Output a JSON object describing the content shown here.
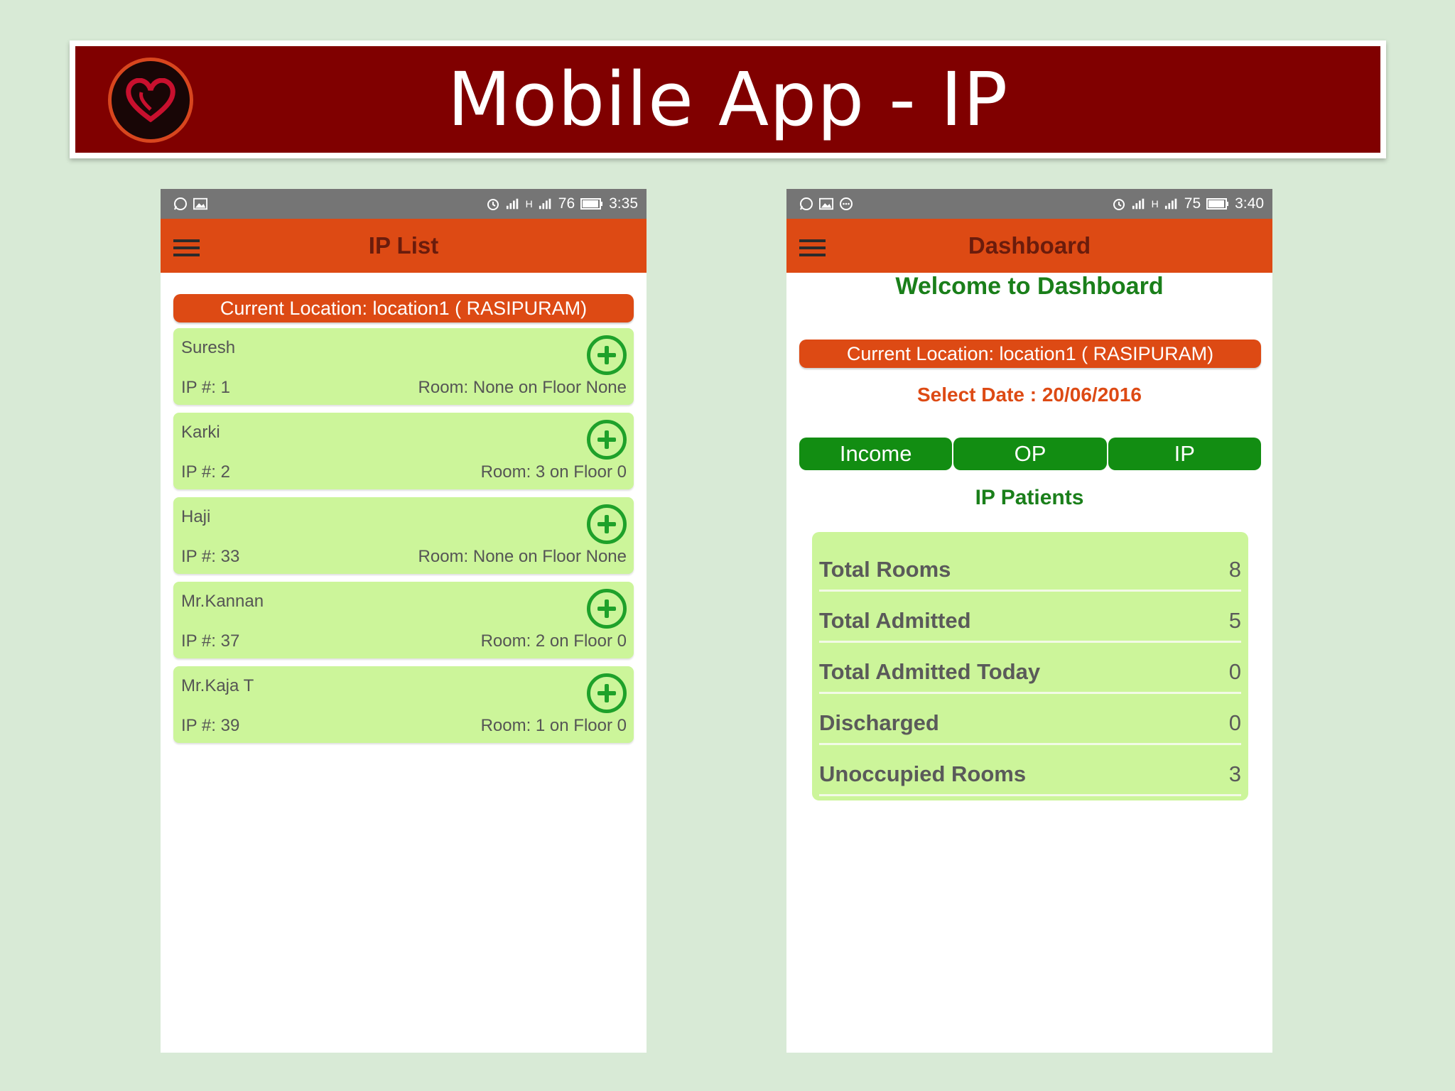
{
  "slide": {
    "title": "Mobile App - IP"
  },
  "colors": {
    "banner": "#800000",
    "appbar": "#dd4a14",
    "card": "#ccf59a",
    "green": "#128d12"
  },
  "left_phone": {
    "status": {
      "signal_text": "H",
      "battery": "76",
      "time": "3:35"
    },
    "appbar_title": "IP List",
    "location": "Current Location: location1 ( RASIPURAM)",
    "patients": [
      {
        "name": "Suresh",
        "ip": "IP #: 1",
        "room": "Room: None on Floor None"
      },
      {
        "name": "Karki",
        "ip": "IP #: 2",
        "room": "Room: 3 on Floor 0"
      },
      {
        "name": "Haji",
        "ip": "IP #: 33",
        "room": "Room: None on Floor None"
      },
      {
        "name": "Mr.Kannan",
        "ip": "IP #: 37",
        "room": "Room: 2 on Floor 0"
      },
      {
        "name": "Mr.Kaja T",
        "ip": "IP #: 39",
        "room": "Room: 1 on Floor 0"
      }
    ]
  },
  "right_phone": {
    "status": {
      "signal_text": "H",
      "battery": "75",
      "time": "3:40"
    },
    "appbar_title": "Dashboard",
    "welcome": "Welcome to Dashboard",
    "location": "Current Location: location1 ( RASIPURAM)",
    "select_date": "Select Date : 20/06/2016",
    "tabs": [
      "Income",
      "OP",
      "IP"
    ],
    "section_title": "IP Patients",
    "stats": [
      {
        "label": "Total Rooms",
        "value": "8"
      },
      {
        "label": "Total Admitted",
        "value": "5"
      },
      {
        "label": "Total Admitted Today",
        "value": "0"
      },
      {
        "label": "Discharged",
        "value": "0"
      },
      {
        "label": "Unoccupied Rooms",
        "value": "3"
      }
    ]
  }
}
